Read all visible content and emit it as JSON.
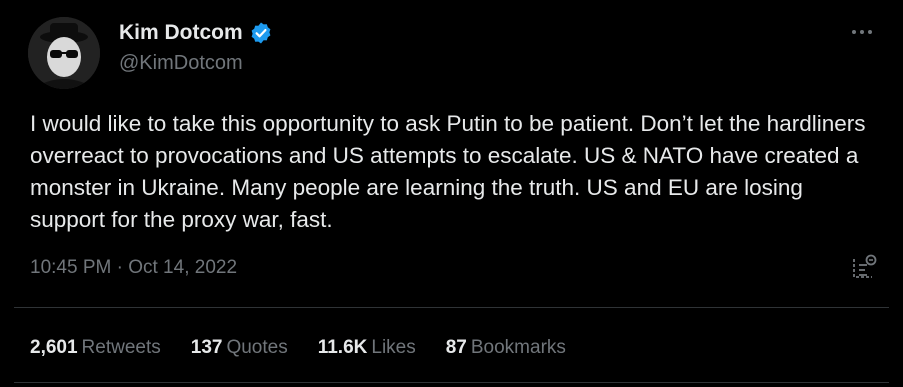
{
  "author": {
    "name": "Kim Dotcom",
    "handle": "@KimDotcom",
    "verified": true,
    "verified_color": "#1d9bf0"
  },
  "more_icon": "more-horizontal-icon",
  "tweet": {
    "text": "I would like to take this opportunity to ask Putin to be patient. Don’t let the hardliners overreact to provocations and US attempts to escalate. US & NATO have created a monster in Ukraine. Many people are learning the truth. US and EU are losing support for the proxy war, fast.",
    "time": "10:45 PM",
    "separator": " · ",
    "date": "Oct 14, 2022"
  },
  "analytics_icon": "analytics-icon",
  "stats": [
    {
      "count": "2,601",
      "label": "Retweets"
    },
    {
      "count": "137",
      "label": "Quotes"
    },
    {
      "count": "11.6K",
      "label": "Likes"
    },
    {
      "count": "87",
      "label": "Bookmarks"
    }
  ],
  "colors": {
    "background": "#000000",
    "primary_text": "#e7e9ea",
    "secondary_text": "#71767b",
    "border": "#2f3336"
  }
}
